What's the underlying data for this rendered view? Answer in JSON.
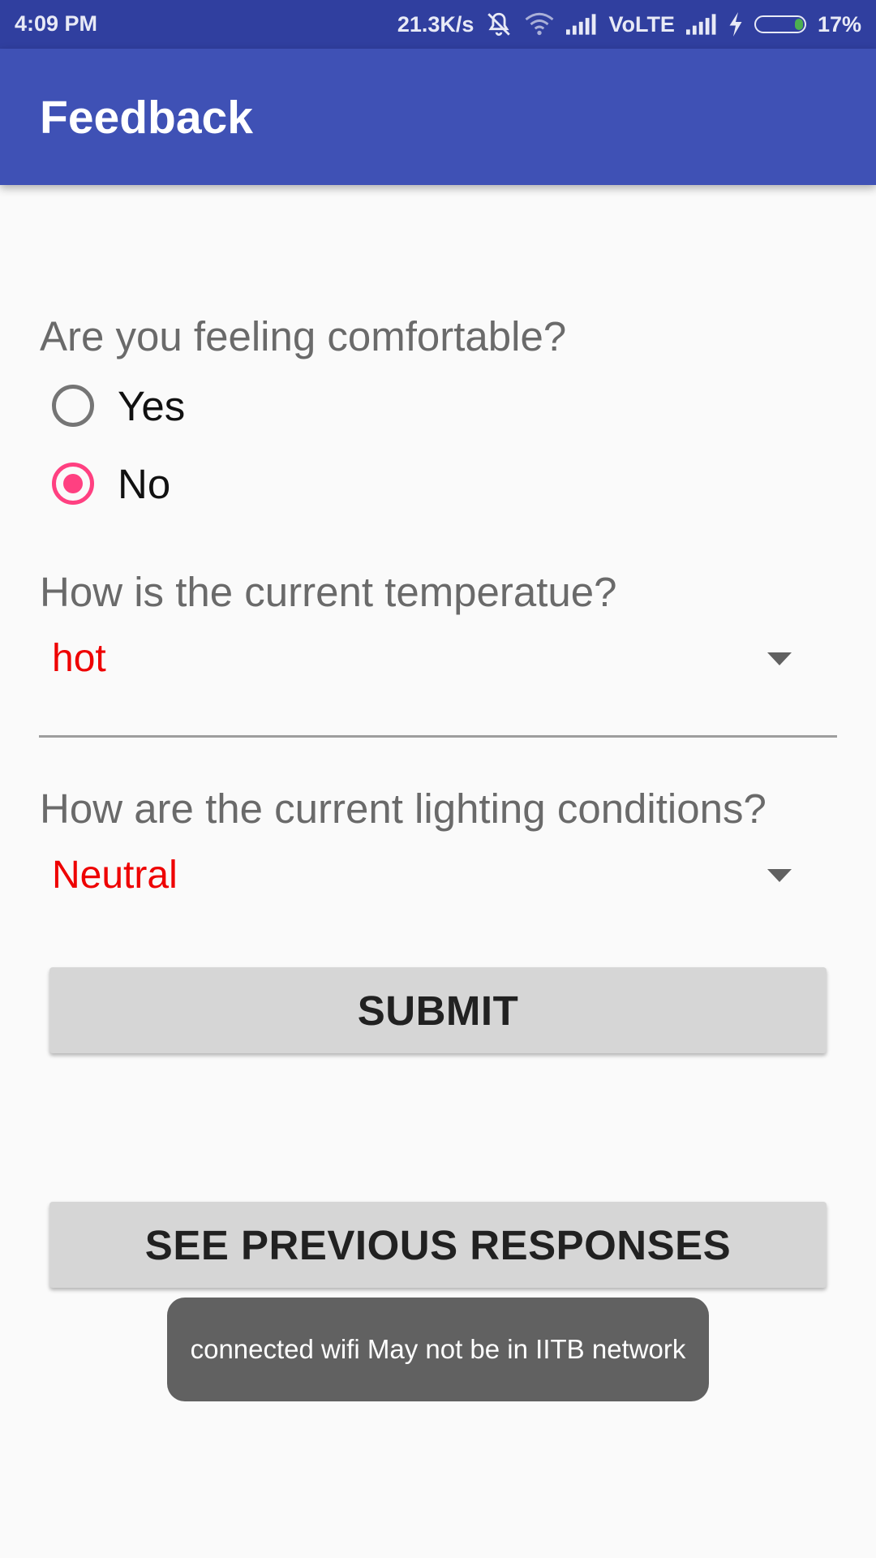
{
  "status_bar": {
    "time": "4:09 PM",
    "net_speed": "21.3K/s",
    "network_label": "VoLTE",
    "battery_percent": "17%",
    "battery_level": 0.17,
    "icons": [
      "mute-icon",
      "wifi-icon",
      "signal-icon",
      "signal-icon",
      "charging-icon",
      "battery-icon"
    ]
  },
  "app_bar": {
    "title": "Feedback"
  },
  "form": {
    "comfort": {
      "question": "Are you feeling comfortable?",
      "options": [
        {
          "label": "Yes",
          "selected": false
        },
        {
          "label": "No",
          "selected": true
        }
      ]
    },
    "temperature": {
      "question": "How is the current temperatue?",
      "selected": "hot"
    },
    "lighting": {
      "question": "How are the current lighting conditions?",
      "selected": "Neutral"
    }
  },
  "buttons": {
    "submit_label": "SUBMIT",
    "previous_label": "SEE PREVIOUS RESPONSES"
  },
  "toast": {
    "message": "connected wifi May not be in IITB network"
  },
  "colors": {
    "status_bar": "#303f9f",
    "app_bar": "#3f51b5",
    "accent": "#ff4081",
    "spinner_text": "#ee0000",
    "background": "#fafafa",
    "button": "#d6d6d6",
    "toast": "#616161"
  }
}
